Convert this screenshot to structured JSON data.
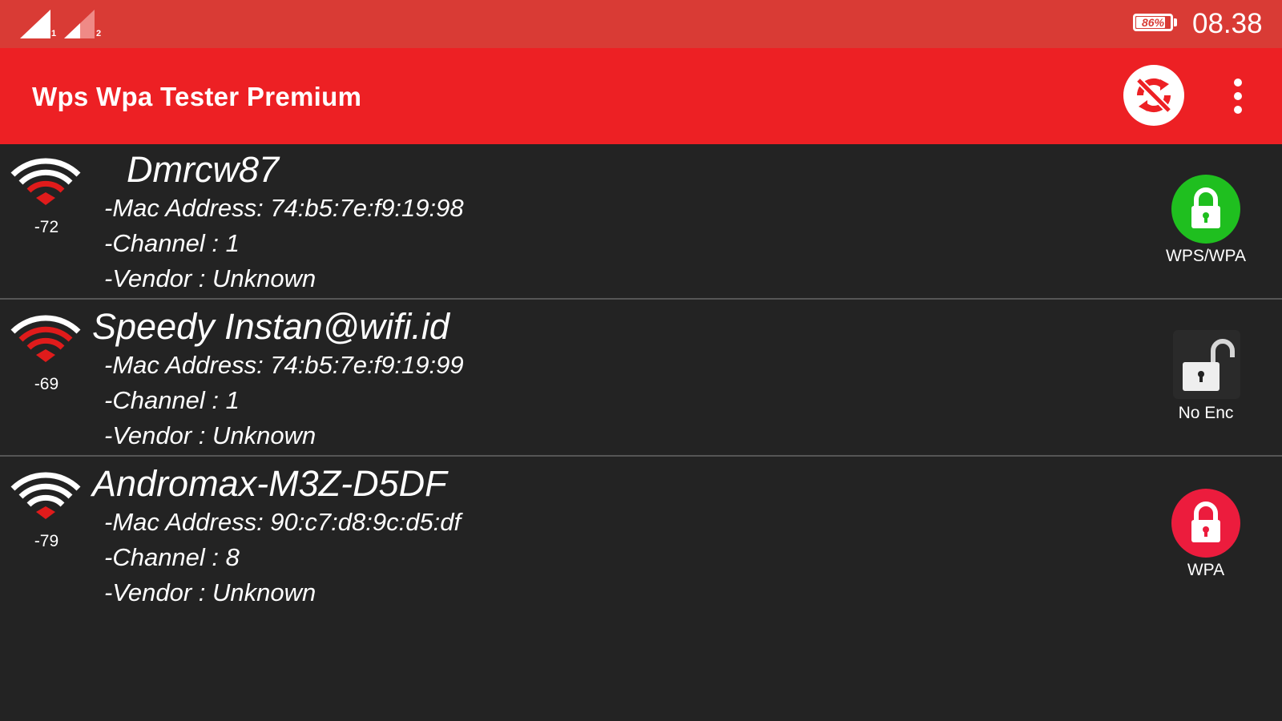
{
  "status_bar": {
    "sim1_label": "1",
    "sim2_label": "2",
    "battery_text": "86%",
    "battery_level": 0.86,
    "time": "08.38"
  },
  "app_bar": {
    "title": "Wps Wpa Tester Premium",
    "refresh_icon": "refresh-off-icon",
    "menu_icon": "overflow-menu-icon"
  },
  "colors": {
    "status_bar": "#d93b35",
    "app_bar": "#ed2024",
    "background": "#232323",
    "wps_wpa": "#1fbf1f",
    "wpa": "#ec1c3d",
    "signal_red": "#e01b1b"
  },
  "networks": [
    {
      "ssid": "Dmrcw87",
      "signal": "-72",
      "mac": "-Mac Address: 74:b5:7e:f9:19:98",
      "channel": "-Channel : 1",
      "vendor": "-Vendor : Unknown",
      "encryption": "WPS/WPA",
      "enc_icon": "lock-green-icon"
    },
    {
      "ssid": "Speedy Instan@wifi.id",
      "signal": "-69",
      "mac": "-Mac Address: 74:b5:7e:f9:19:99",
      "channel": "-Channel : 1",
      "vendor": "-Vendor : Unknown",
      "encryption": "No Enc",
      "enc_icon": "unlock-icon"
    },
    {
      "ssid": "Andromax-M3Z-D5DF",
      "signal": "-79",
      "mac": "-Mac Address: 90:c7:d8:9c:d5:df",
      "channel": "-Channel : 8",
      "vendor": "-Vendor : Unknown",
      "encryption": "WPA",
      "enc_icon": "lock-red-icon"
    }
  ]
}
